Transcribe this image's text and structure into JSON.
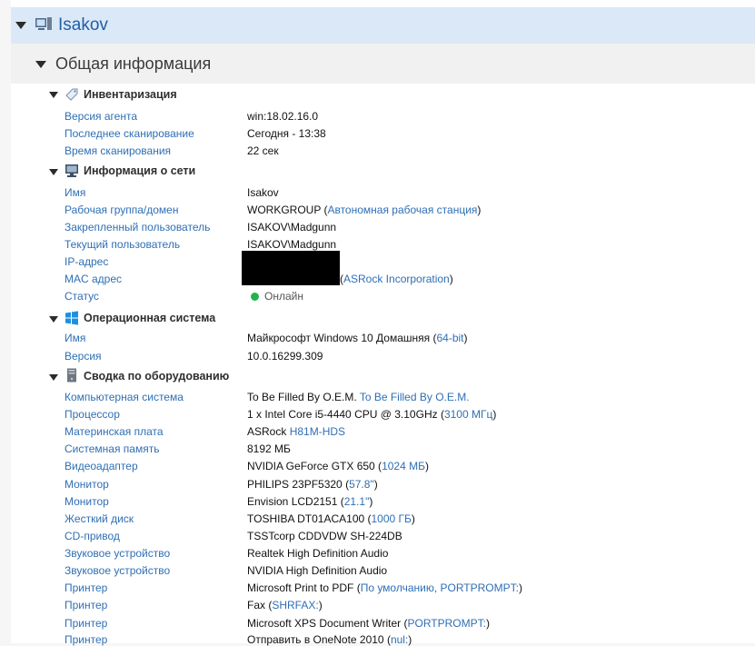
{
  "computer": {
    "name": "Isakov"
  },
  "general_title": "Общая информация",
  "inventory": {
    "title": "Инвентаризация",
    "rows": [
      {
        "label": "Версия агента",
        "value": "win:18.02.16.0"
      },
      {
        "label": "Последнее сканирование",
        "value": "Сегодня - 13:38"
      },
      {
        "label": "Время сканирования",
        "value": "22 сек"
      }
    ]
  },
  "network": {
    "title": "Информация о сети",
    "name": {
      "label": "Имя",
      "value": "Isakov"
    },
    "workgroup": {
      "label": "Рабочая группа/домен",
      "value": "WORKGROUP (",
      "link": "Автономная рабочая станция",
      "tail": ")"
    },
    "assigned_user": {
      "label": "Закрепленный пользователь",
      "value": "ISAKOV\\Madgunn"
    },
    "current_user": {
      "label": "Текущий пользователь",
      "value": "ISAKOV\\Madgunn"
    },
    "ip": {
      "label": "IP-адрес"
    },
    "mac": {
      "label": "MAC адрес",
      "prefix": "(",
      "link": "ASRock Incorporation",
      "tail": ")"
    },
    "status": {
      "label": "Статус",
      "value": "Онлайн",
      "color": "#22b24c"
    }
  },
  "os": {
    "title": "Операционная система",
    "name": {
      "label": "Имя",
      "value": "Майкрософт Windows 10 Домашняя (",
      "link": "64-bit",
      "tail": ")"
    },
    "version": {
      "label": "Версия",
      "value": "10.0.16299.309"
    }
  },
  "hardware": {
    "title": "Сводка по оборудованию",
    "computer": {
      "label": "Компьютерная система",
      "value": "To Be Filled By O.E.M. ",
      "link": "To Be Filled By O.E.M."
    },
    "cpu": {
      "label": "Процессор",
      "value": "1 x Intel Core i5-4440 CPU @ 3.10GHz (",
      "link": "3100 МГц",
      "tail": ")"
    },
    "board": {
      "label": "Материнская плата",
      "value": "ASRock ",
      "link": "H81M-HDS"
    },
    "memory": {
      "label": "Системная память",
      "value": "8192 МБ"
    },
    "video": {
      "label": "Видеоадаптер",
      "value": "NVIDIA GeForce GTX 650 (",
      "link": "1024 МБ",
      "tail": ")"
    },
    "monitor1": {
      "label": "Монитор",
      "value": "PHILIPS 23PF5320 (",
      "link": "57.8\"",
      "tail": ")"
    },
    "monitor2": {
      "label": "Монитор",
      "value": "Envision LCD2151 (",
      "link": "21.1\"",
      "tail": ")"
    },
    "disk": {
      "label": "Жесткий диск",
      "value": "TOSHIBA DT01ACA100 (",
      "link": "1000 ГБ",
      "tail": ")"
    },
    "cdrom": {
      "label": "CD-привод",
      "value": "TSSTcorp CDDVDW SH-224DB"
    },
    "sound1": {
      "label": "Звуковое устройство",
      "value": "Realtek High Definition Audio"
    },
    "sound2": {
      "label": "Звуковое устройство",
      "value": "NVIDIA High Definition Audio"
    },
    "printer1": {
      "label": "Принтер",
      "value": "Microsoft Print to PDF (",
      "link": "По умолчанию, PORTPROMPT:",
      "tail": ")"
    },
    "printer2": {
      "label": "Принтер",
      "value": "Fax (",
      "link": "SHRFAX:",
      "tail": ")"
    },
    "printer3": {
      "label": "Принтер",
      "value": "Microsoft XPS Document Writer (",
      "link": "PORTPROMPT:",
      "tail": ")"
    },
    "printer4": {
      "label": "Принтер",
      "value": "Отправить в OneNote 2010 (",
      "link": "nul:",
      "tail": ")"
    }
  }
}
